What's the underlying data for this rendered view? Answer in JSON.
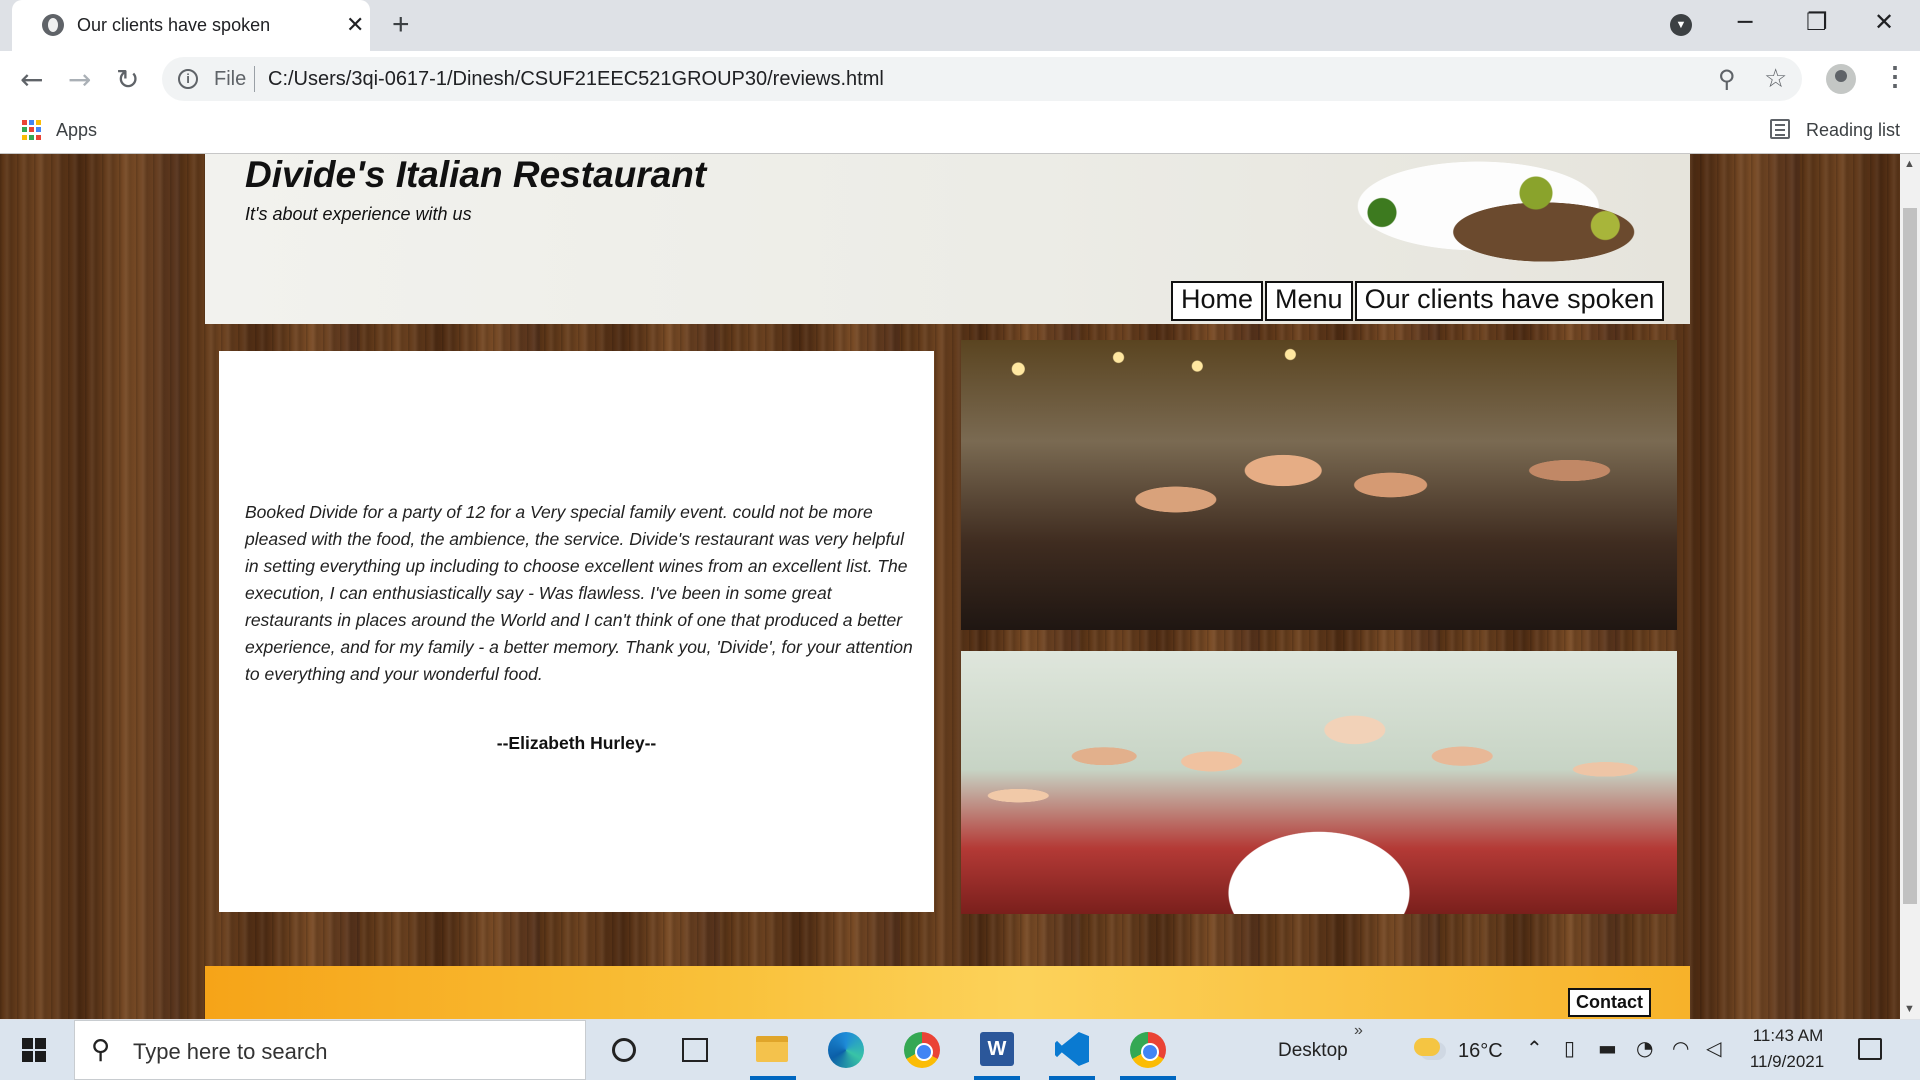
{
  "browser": {
    "tab_title": "Our clients have spoken",
    "new_tab": "+",
    "url_scheme": "File",
    "url": "C:/Users/3qi-0617-1/Dinesh/CSUF21EEC521GROUP30/reviews.html",
    "bookmarks": {
      "apps_label": "Apps",
      "reading_list_label": "Reading list"
    }
  },
  "site": {
    "title": "Divide's Italian Restaurant",
    "tagline": "It's about experience with us",
    "nav": [
      {
        "label": "Home"
      },
      {
        "label": "Menu"
      },
      {
        "label": "Our clients have spoken"
      }
    ],
    "review": {
      "text": "Booked Divide for a party of 12 for a Very special family event. could not be more pleased with the food, the ambience, the service. Divide's restaurant was very helpful in setting everything up including to choose excellent wines from an excellent list. The execution, I can enthusiastically say - Was flawless. I've been in some great restaurants in places around the World and I can't think of one that produced a better experience, and for my family - a better memory. Thank you, 'Divide', for your attention to everything and your wonderful food.",
      "author": "--Elizabeth Hurley--"
    },
    "footer": {
      "contact_label": "Contact"
    }
  },
  "taskbar": {
    "search_placeholder": "Type here to search",
    "desktop_label": "Desktop",
    "temperature": "16°C",
    "time": "11:43 AM",
    "date": "11/9/2021"
  },
  "colors": {
    "accent": "#0067c0",
    "wood": "#6f4421",
    "footer_orange": "#f9c13a"
  }
}
